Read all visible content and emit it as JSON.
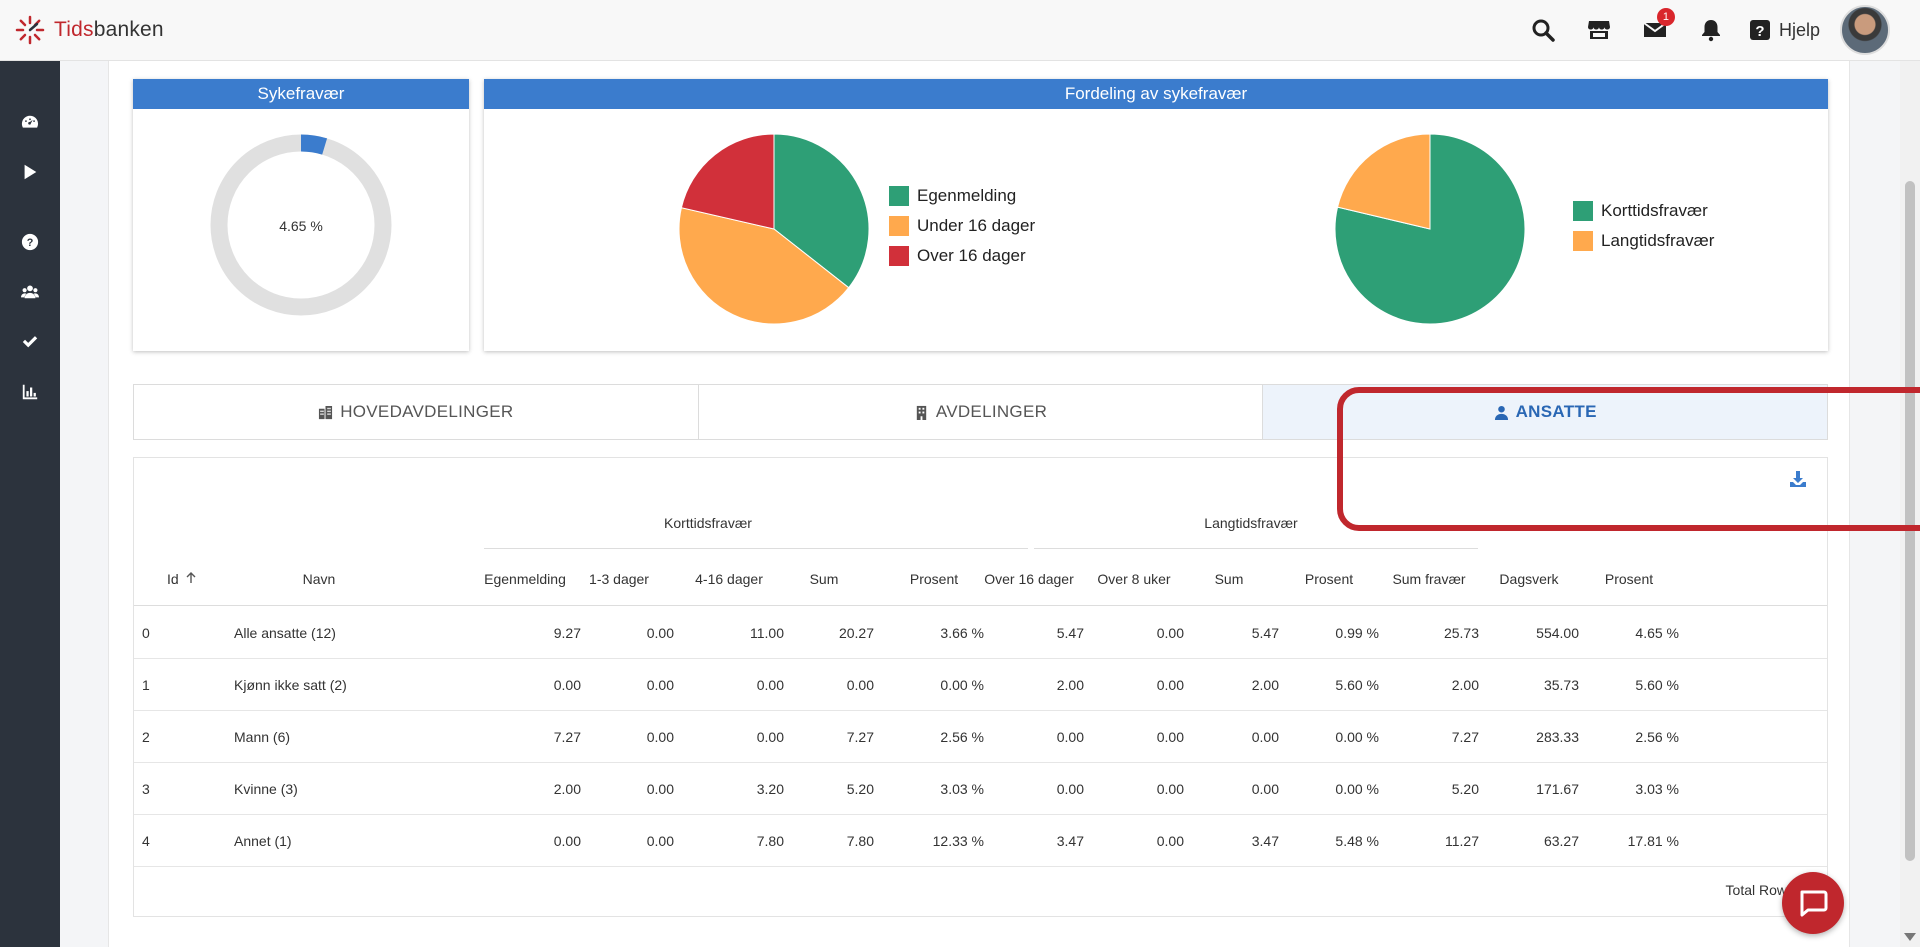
{
  "app": {
    "logo_text_a": "Tids",
    "logo_text_b": "banken",
    "notification_count": "1",
    "help_label": "Hjelp"
  },
  "colors": {
    "accent": "#3b7ccd",
    "brand_red": "#c0272d",
    "green": "#2e9f76",
    "orange": "#ffa94d",
    "red": "#d1303a",
    "donut_track": "#e0e0e0"
  },
  "sykefravaer": {
    "title": "Sykefravær",
    "value_label": "4.65 %",
    "percent": 4.65
  },
  "fordeling": {
    "title": "Fordeling av sykefravær"
  },
  "chart_data": [
    {
      "type": "pie",
      "categories": [
        "Egenmelding",
        "Under 16 dager",
        "Over 16 dager"
      ],
      "values": [
        35.6,
        43.0,
        21.4
      ],
      "colors": [
        "#2e9f76",
        "#ffa94d",
        "#d1303a"
      ]
    },
    {
      "type": "pie",
      "categories": [
        "Korttidsfravær",
        "Langtidsfravær"
      ],
      "values": [
        78.7,
        21.3
      ],
      "colors": [
        "#2e9f76",
        "#ffa94d"
      ]
    }
  ],
  "tabs": [
    {
      "label": "HOVEDAVDELINGER",
      "icon": "building-icon",
      "active": false
    },
    {
      "label": "AVDELINGER",
      "icon": "office-icon",
      "active": false
    },
    {
      "label": "ANSATTE",
      "icon": "user-icon",
      "active": true
    }
  ],
  "table": {
    "group_headers": [
      "Korttidsfravær",
      "Langtidsfravær"
    ],
    "columns": [
      "Id",
      "Navn",
      "Egenmelding",
      "1-3 dager",
      "4-16 dager",
      "Sum",
      "Prosent",
      "Over 16 dager",
      "Over 8 uker",
      "Sum",
      "Prosent",
      "Sum fravær",
      "Dagsverk",
      "Prosent"
    ],
    "rows": [
      [
        "0",
        "Alle ansatte (12)",
        "9.27",
        "0.00",
        "11.00",
        "20.27",
        "3.66 %",
        "5.47",
        "0.00",
        "5.47",
        "0.99 %",
        "25.73",
        "554.00",
        "4.65 %"
      ],
      [
        "1",
        "Kjønn ikke satt (2)",
        "0.00",
        "0.00",
        "0.00",
        "0.00",
        "0.00 %",
        "2.00",
        "0.00",
        "2.00",
        "5.60 %",
        "2.00",
        "35.73",
        "5.60 %"
      ],
      [
        "2",
        "Mann (6)",
        "7.27",
        "0.00",
        "0.00",
        "7.27",
        "2.56 %",
        "0.00",
        "0.00",
        "0.00",
        "0.00 %",
        "7.27",
        "283.33",
        "2.56 %"
      ],
      [
        "3",
        "Kvinne (3)",
        "2.00",
        "0.00",
        "3.20",
        "5.20",
        "3.03 %",
        "0.00",
        "0.00",
        "0.00",
        "0.00 %",
        "5.20",
        "171.67",
        "3.03 %"
      ],
      [
        "4",
        "Annet (1)",
        "0.00",
        "0.00",
        "7.80",
        "7.80",
        "12.33 %",
        "3.47",
        "0.00",
        "3.47",
        "5.48 %",
        "11.27",
        "63.27",
        "17.81 %"
      ]
    ],
    "footer": "Total Row"
  }
}
